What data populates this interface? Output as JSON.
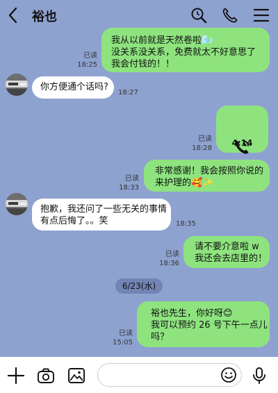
{
  "header": {
    "title": "裕也",
    "back_icon": "chevron-left-icon",
    "search_icon": "search-icon",
    "call_icon": "phone-icon",
    "menu_icon": "menu-icon"
  },
  "messages": [
    {
      "dir": "out",
      "text": "我从以前就是天然卷啦🌬️\n没关系没关系，免费就太不好意思了\n我会付钱的！！",
      "status": "已读",
      "time": "18:25"
    },
    {
      "dir": "in",
      "text": "你方便通个话吗?",
      "time": "18:27"
    },
    {
      "dir": "out",
      "type": "call",
      "duration": "4:14",
      "status": "已读",
      "time": "18:28"
    },
    {
      "dir": "out",
      "text": "非常感谢！我会按照你说的\n来护理的🥰✨",
      "status": "已读",
      "time": "18:33"
    },
    {
      "dir": "in",
      "text": "抱歉，我还问了一些无关的事情\n有点后悔了。。笑",
      "time": "18:35"
    },
    {
      "dir": "out",
      "text": "请不要介意啦 w\n我还会去店里的！",
      "status": "已读",
      "time": "18:36"
    },
    {
      "dir": "out",
      "text": "裕也先生，你好呀😊\n我可以预约 26 号下午一点儿\n吗？",
      "status": "已读",
      "time": "15:05"
    }
  ],
  "date_separator": "6/23(水)",
  "input_bar": {
    "add_icon": "plus-icon",
    "camera_icon": "camera-icon",
    "image_icon": "image-icon",
    "emoji_icon": "emoji-icon",
    "mic_icon": "microphone-icon",
    "placeholder": ""
  },
  "colors": {
    "background": "#8ea2d0",
    "outgoing_bubble": "#8ee37f",
    "incoming_bubble": "#ffffff",
    "date_chip": "#7284b4"
  }
}
